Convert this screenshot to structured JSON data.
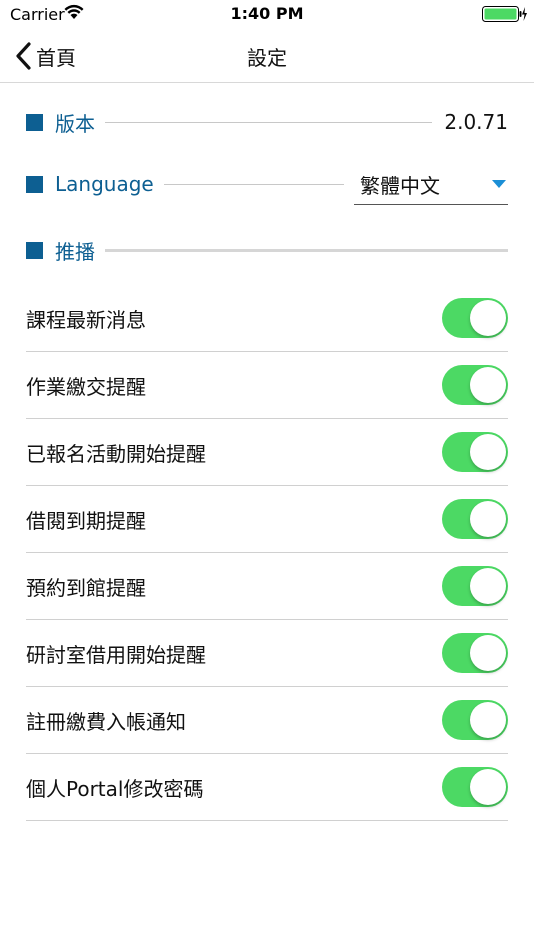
{
  "status_bar": {
    "carrier": "Carrier",
    "time": "1:40 PM",
    "wifi_icon": "wifi-icon",
    "battery_icon": "battery-charging-icon"
  },
  "nav": {
    "back_label": "首頁",
    "title": "設定"
  },
  "version": {
    "label": "版本",
    "value": "2.0.71"
  },
  "language": {
    "label": "Language",
    "selected": "繁體中文"
  },
  "push": {
    "label": "推播",
    "items": [
      {
        "label": "課程最新消息",
        "on": true
      },
      {
        "label": "作業繳交提醒",
        "on": true
      },
      {
        "label": "已報名活動開始提醒",
        "on": true
      },
      {
        "label": "借閱到期提醒",
        "on": true
      },
      {
        "label": "預約到館提醒",
        "on": true
      },
      {
        "label": "研討室借用開始提醒",
        "on": true
      },
      {
        "label": "註冊繳費入帳通知",
        "on": true
      },
      {
        "label": "個人Portal修改密碼",
        "on": true
      }
    ]
  },
  "colors": {
    "accent": "#0d5f92",
    "toggle_on": "#4cd964",
    "battery": "#4cd964"
  }
}
